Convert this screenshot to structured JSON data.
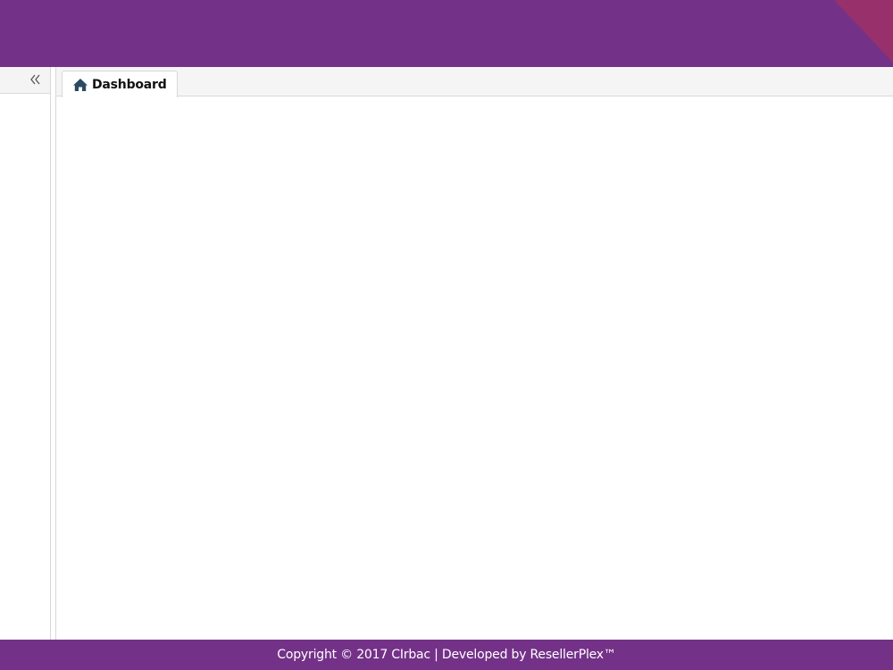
{
  "colors": {
    "header_bg": "#743188",
    "header_corner": "#97306b",
    "footer_bg": "#743188",
    "tab_icon": "#2c4a63"
  },
  "sidebar": {
    "toggle_icon": "double-chevron-left-icon"
  },
  "tabs": [
    {
      "label": "Dashboard",
      "icon": "home-icon",
      "active": true
    }
  ],
  "footer": {
    "text": "Copyright © 2017 CIrbac | Developed by ResellerPlex™"
  }
}
